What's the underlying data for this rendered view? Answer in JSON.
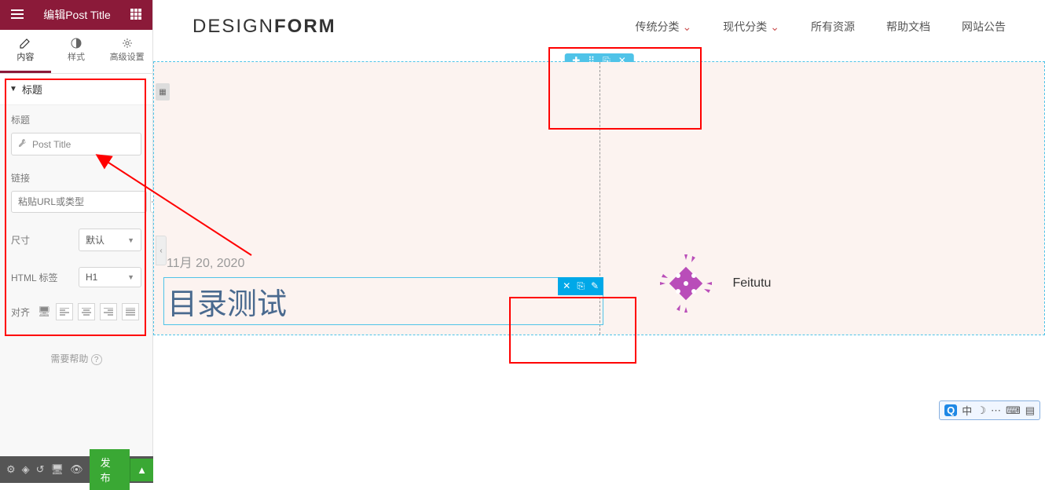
{
  "header": {
    "title": "编辑Post Title"
  },
  "tabs": [
    {
      "label": "内容"
    },
    {
      "label": "样式"
    },
    {
      "label": "高级设置"
    }
  ],
  "section_title": "标题",
  "controls": {
    "title": {
      "label": "标题",
      "value": "Post Title"
    },
    "link": {
      "label": "链接",
      "placeholder": "粘贴URL或类型"
    },
    "size": {
      "label": "尺寸",
      "value": "默认"
    },
    "html_tag": {
      "label": "HTML 标签",
      "value": "H1"
    },
    "align": {
      "label": "对齐"
    }
  },
  "help_text": "需要帮助",
  "footer": {
    "publish": "发布"
  },
  "site": {
    "logo1": "DESIGN",
    "logo2": "FORM",
    "nav": [
      {
        "label": "传统分类",
        "has_dropdown": true
      },
      {
        "label": "现代分类",
        "has_dropdown": true
      },
      {
        "label": "所有资源"
      },
      {
        "label": "帮助文档"
      },
      {
        "label": "网站公告"
      }
    ],
    "post_date": "11月 20, 2020",
    "post_title": "目录测试",
    "author": "Feitutu"
  },
  "ime": {
    "char": "中"
  }
}
